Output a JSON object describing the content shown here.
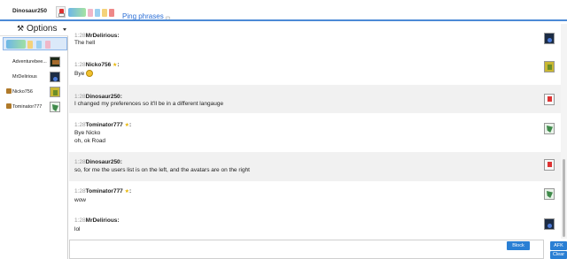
{
  "header": {
    "username": "Dinosaur250",
    "ping_label": "Ping phrases",
    "ping_count": "(?)"
  },
  "sidebar": {
    "options_label": "Options",
    "users": [
      {
        "name": "Adventurebee...",
        "avatar": "pixel-avatar"
      },
      {
        "name": "MrDelirious",
        "avatar": "dark-avatar"
      },
      {
        "name": "Nicko756",
        "avatar": "gold-avatar"
      },
      {
        "name": "Tominator777",
        "avatar": "green-avatar"
      }
    ]
  },
  "messages": [
    {
      "time": "1:28",
      "user": "MrDelirious",
      "star": false,
      "lines": [
        "The hell"
      ],
      "avatar": "dark-avatar"
    },
    {
      "time": "1:28",
      "user": "Nicko756",
      "star": true,
      "lines": [
        "Bye"
      ],
      "emoji": "smiley-icon",
      "avatar": "gold-avatar"
    },
    {
      "time": "1:28",
      "user": "Dinosaur250",
      "star": false,
      "lines": [
        "I changed my preferences so it'll be in a different langauge"
      ],
      "avatar": "red-avatar"
    },
    {
      "time": "1:28",
      "user": "Tominator777",
      "star": true,
      "lines": [
        "Bye Nicko",
        "oh, ok Road"
      ],
      "avatar": "green-avatar"
    },
    {
      "time": "1:28",
      "user": "Dinosaur250",
      "star": false,
      "lines": [
        "so, for me the users list is on the left, and the avatars are on the right"
      ],
      "avatar": "red-avatar"
    },
    {
      "time": "1:28",
      "user": "Tominator777",
      "star": true,
      "lines": [
        "wow"
      ],
      "avatar": "green-avatar"
    },
    {
      "time": "1:28",
      "user": "MrDelirious",
      "star": false,
      "lines": [
        "lol"
      ],
      "avatar": "dark-avatar"
    }
  ],
  "controls": {
    "block_label": "Block",
    "afk_label": "AFK",
    "clear_label": "Clear",
    "input_value": ""
  },
  "colors": {
    "accent": "#2a7fd4",
    "header_border": "#4c8ad6",
    "alt_row": "#f1f1f1"
  }
}
